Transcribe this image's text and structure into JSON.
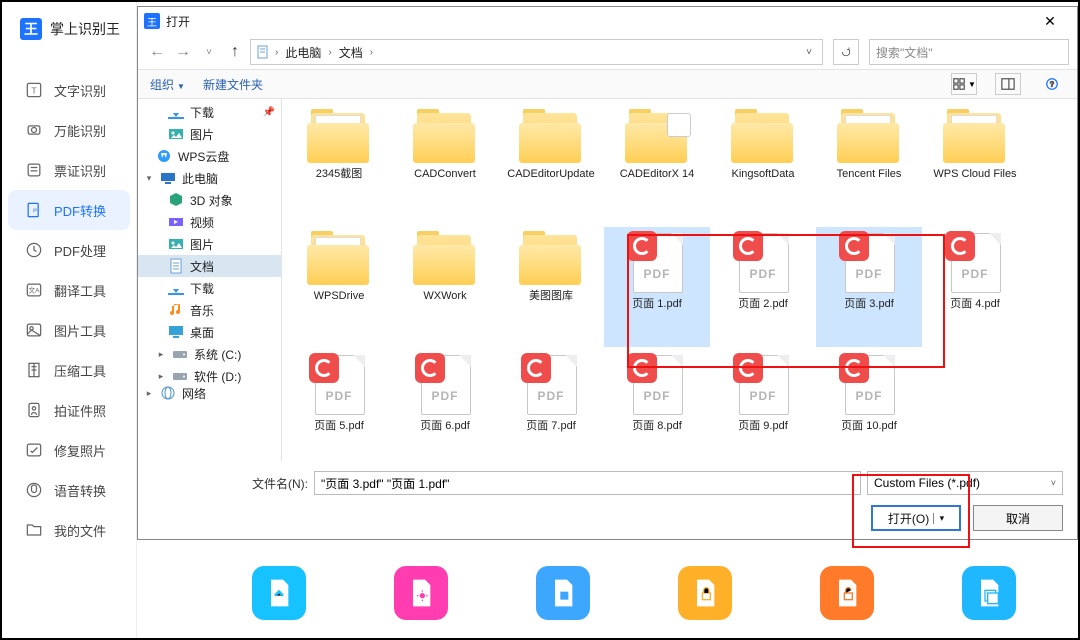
{
  "app": {
    "title": "掌上识别王",
    "nav": [
      {
        "label": "文字识别"
      },
      {
        "label": "万能识别"
      },
      {
        "label": "票证识别"
      },
      {
        "label": "PDF转换"
      },
      {
        "label": "PDF处理"
      },
      {
        "label": "翻译工具"
      },
      {
        "label": "图片工具"
      },
      {
        "label": "压缩工具"
      },
      {
        "label": "拍证件照"
      },
      {
        "label": "修复照片"
      },
      {
        "label": "语音转换"
      },
      {
        "label": "我的文件"
      }
    ],
    "active_index": 3
  },
  "dialog": {
    "title": "打开",
    "path": {
      "root": "此电脑",
      "segs": [
        "文档"
      ]
    },
    "search_placeholder": "搜索\"文档\"",
    "toolbar": {
      "organize": "组织",
      "new_folder": "新建文件夹"
    },
    "tree": [
      {
        "label": "下载",
        "indent": true,
        "icon": "download",
        "pin": true
      },
      {
        "label": "图片",
        "indent": true,
        "icon": "pictures"
      },
      {
        "label": "WPS云盘",
        "indent": false,
        "icon": "wps"
      },
      {
        "label": "此电脑",
        "indent": false,
        "icon": "pc",
        "expander": "open"
      },
      {
        "label": "3D 对象",
        "indent": true,
        "icon": "3d"
      },
      {
        "label": "视频",
        "indent": true,
        "icon": "video"
      },
      {
        "label": "图片",
        "indent": true,
        "icon": "pictures"
      },
      {
        "label": "文档",
        "indent": true,
        "icon": "docs",
        "selected": true
      },
      {
        "label": "下载",
        "indent": true,
        "icon": "download"
      },
      {
        "label": "音乐",
        "indent": true,
        "icon": "music"
      },
      {
        "label": "桌面",
        "indent": true,
        "icon": "desktop"
      },
      {
        "label": "系统 (C:)",
        "indent": true,
        "icon": "drive",
        "expander": "closed"
      },
      {
        "label": "软件 (D:)",
        "indent": true,
        "icon": "drive",
        "expander": "closed"
      },
      {
        "label": "网络",
        "indent": false,
        "icon": "net",
        "expander": "closed",
        "cut": true
      }
    ],
    "files": {
      "row1": [
        {
          "label": "2345截图",
          "type": "folder-open"
        },
        {
          "label": "CADConvert",
          "type": "folder"
        },
        {
          "label": "CADEditorUpdate",
          "type": "folder"
        },
        {
          "label": "CADEditorX 14",
          "type": "folder-special"
        },
        {
          "label": "KingsoftData",
          "type": "folder"
        },
        {
          "label": "Tencent Files",
          "type": "folder-open"
        },
        {
          "label": "WPS Cloud Files",
          "type": "folder-open"
        }
      ],
      "row2": [
        {
          "label": "WPSDrive",
          "type": "folder-open"
        },
        {
          "label": "WXWork",
          "type": "folder"
        },
        {
          "label": "美图图库",
          "type": "folder"
        },
        {
          "label": "页面 1.pdf",
          "type": "pdf",
          "selected": true
        },
        {
          "label": "页面 2.pdf",
          "type": "pdf"
        },
        {
          "label": "页面 3.pdf",
          "type": "pdf",
          "selected": true
        },
        {
          "label": "页面 4.pdf",
          "type": "pdf"
        }
      ],
      "row3": [
        {
          "label": "页面 5.pdf",
          "type": "pdf"
        },
        {
          "label": "页面 6.pdf",
          "type": "pdf"
        },
        {
          "label": "页面 7.pdf",
          "type": "pdf"
        },
        {
          "label": "页面 8.pdf",
          "type": "pdf"
        },
        {
          "label": "页面 9.pdf",
          "type": "pdf"
        },
        {
          "label": "页面 10.pdf",
          "type": "pdf"
        }
      ]
    },
    "filename_label": "文件名(N):",
    "filename_value": "\"页面 3.pdf\" \"页面 1.pdf\"",
    "filter_value": "Custom Files (*.pdf)",
    "open_label": "打开(O)",
    "open_chev": "▾",
    "cancel_label": "取消"
  }
}
